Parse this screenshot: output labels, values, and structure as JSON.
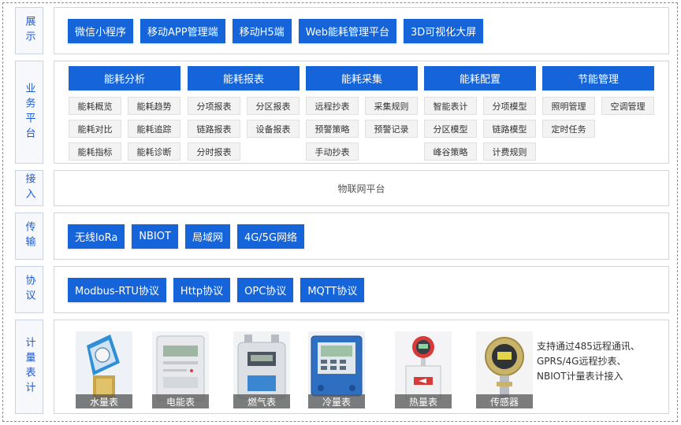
{
  "layers": {
    "display": {
      "label": "展示",
      "buttons": [
        "微信小程序",
        "移动APP管理端",
        "移动H5端",
        "Web能耗管理平台",
        "3D可视化大屏"
      ]
    },
    "business": {
      "label": "业务平台",
      "modules": [
        {
          "title": "能耗分析",
          "items": [
            "能耗概览",
            "能耗趋势",
            "能耗对比",
            "能耗追踪",
            "能耗指标",
            "能耗诊断"
          ]
        },
        {
          "title": "能耗报表",
          "items": [
            "分项报表",
            "分区报表",
            "链路报表",
            "设备报表",
            "分时报表"
          ]
        },
        {
          "title": "能耗采集",
          "items": [
            "远程抄表",
            "采集规则",
            "预警策略",
            "预警记录",
            "手动抄表"
          ]
        },
        {
          "title": "能耗配置",
          "items": [
            "智能表计",
            "分项模型",
            "分区模型",
            "链路模型",
            "峰谷策略",
            "计费规则"
          ]
        },
        {
          "title": "节能管理",
          "items": [
            "照明管理",
            "空调管理",
            "定时任务"
          ]
        }
      ]
    },
    "access": {
      "label": "接入",
      "text": "物联网平台"
    },
    "transport": {
      "label": "传输",
      "buttons": [
        "无线loRa",
        "NBIOT",
        "局域网",
        "4G/5G网络"
      ]
    },
    "protocol": {
      "label": "协议",
      "buttons": [
        "Modbus-RTU协议",
        "Http协议",
        "OPC协议",
        "MQTT协议"
      ]
    },
    "meters": {
      "label": "计量表计",
      "items": [
        {
          "name": "水量表",
          "icon": "water-meter-icon"
        },
        {
          "name": "电能表",
          "icon": "electric-meter-icon"
        },
        {
          "name": "燃气表",
          "icon": "gas-meter-icon"
        },
        {
          "name": "冷量表",
          "icon": "cold-meter-icon"
        },
        {
          "name": "热量表",
          "icon": "heat-meter-icon"
        },
        {
          "name": "传感器",
          "icon": "sensor-icon"
        }
      ],
      "note": "支持通过485远程通讯、GPRS/4G远程抄表、NBIOT计量表计接入"
    }
  },
  "colors": {
    "primary": "#1664d9",
    "label_text": "#1e5bd6",
    "item_bg": "#f3f3f3"
  }
}
